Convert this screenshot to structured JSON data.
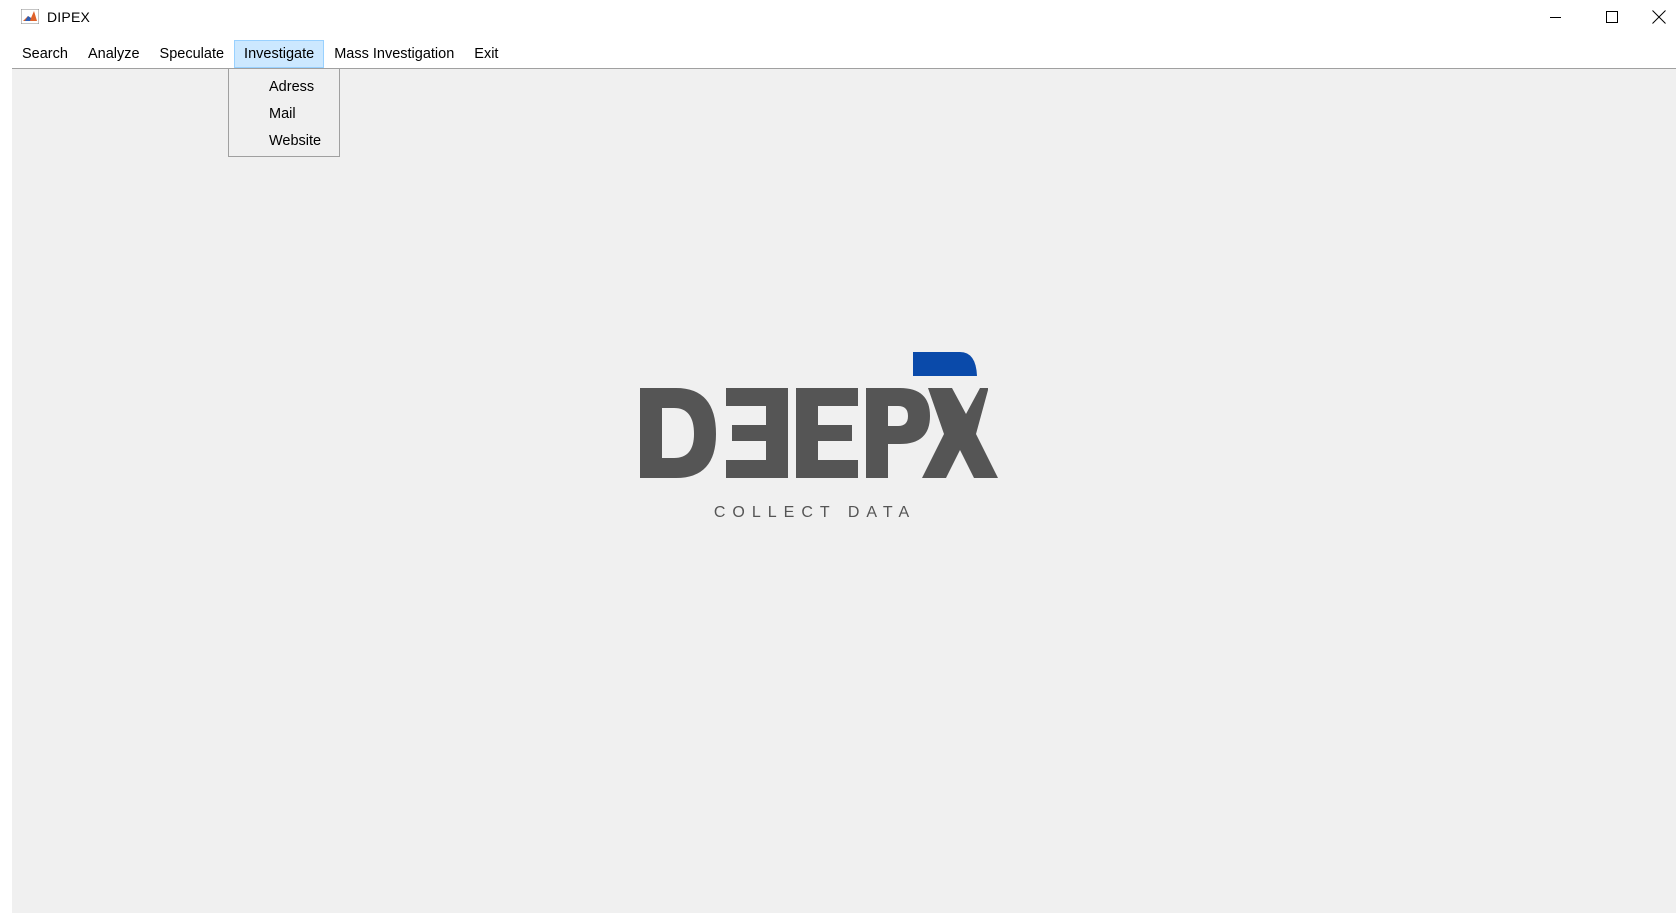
{
  "window": {
    "title": "DIPEX",
    "app_icon": "matlab-icon"
  },
  "controls": {
    "minimize_icon": "minimize-icon",
    "maximize_icon": "maximize-icon",
    "close_icon": "close-icon"
  },
  "menu": {
    "items": [
      {
        "label": "Search"
      },
      {
        "label": "Analyze"
      },
      {
        "label": "Speculate"
      },
      {
        "label": "Investigate",
        "active": true
      },
      {
        "label": "Mass Investigation"
      },
      {
        "label": "Exit"
      }
    ],
    "open_menu": "Investigate",
    "dropdown": [
      {
        "label": "Adress"
      },
      {
        "label": "Mail"
      },
      {
        "label": "Website"
      }
    ]
  },
  "logo": {
    "wordmark": "DEEPX",
    "tagline": "COLLECT DATA",
    "colors": {
      "text": "#555555",
      "accent": "#0a4aaa"
    }
  },
  "colors": {
    "content_bg": "#f0f0f0",
    "menu_active_bg": "#cce8ff",
    "menu_active_border": "#99d1ff"
  }
}
